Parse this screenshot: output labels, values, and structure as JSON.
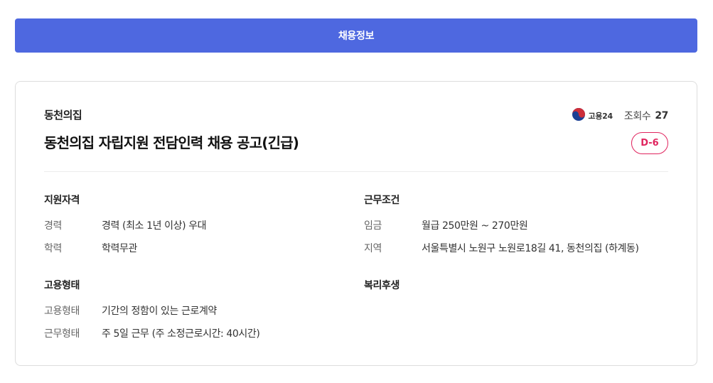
{
  "header": {
    "label": "채용정보"
  },
  "job": {
    "company": "동천의집",
    "title": "동천의집 자립지원 전담인력 채용 공고(긴급)",
    "source_name": "고용24",
    "views_label": "조회수",
    "views_count": "27",
    "dday": "D-6"
  },
  "sections": {
    "qualification": {
      "title": "지원자격",
      "rows": [
        {
          "label": "경력",
          "value": "경력 (최소 1년 이상) 우대"
        },
        {
          "label": "학력",
          "value": "학력무관"
        }
      ]
    },
    "conditions": {
      "title": "근무조건",
      "rows": [
        {
          "label": "임금",
          "value": "월급 250만원 ~ 270만원"
        },
        {
          "label": "지역",
          "value": "서울특별시 노원구 노원로18길 41, 동천의집 (하계동)"
        }
      ]
    },
    "employment": {
      "title": "고용형태",
      "rows": [
        {
          "label": "고용형태",
          "value": "기간의 정함이 있는 근로계약"
        },
        {
          "label": "근무형태",
          "value": "주 5일 근무 (주 소정근로시간: 40시간)"
        }
      ]
    },
    "welfare": {
      "title": "복리후생"
    }
  },
  "colors": {
    "primary": "#4e68e0",
    "dday": "#e0245e"
  }
}
